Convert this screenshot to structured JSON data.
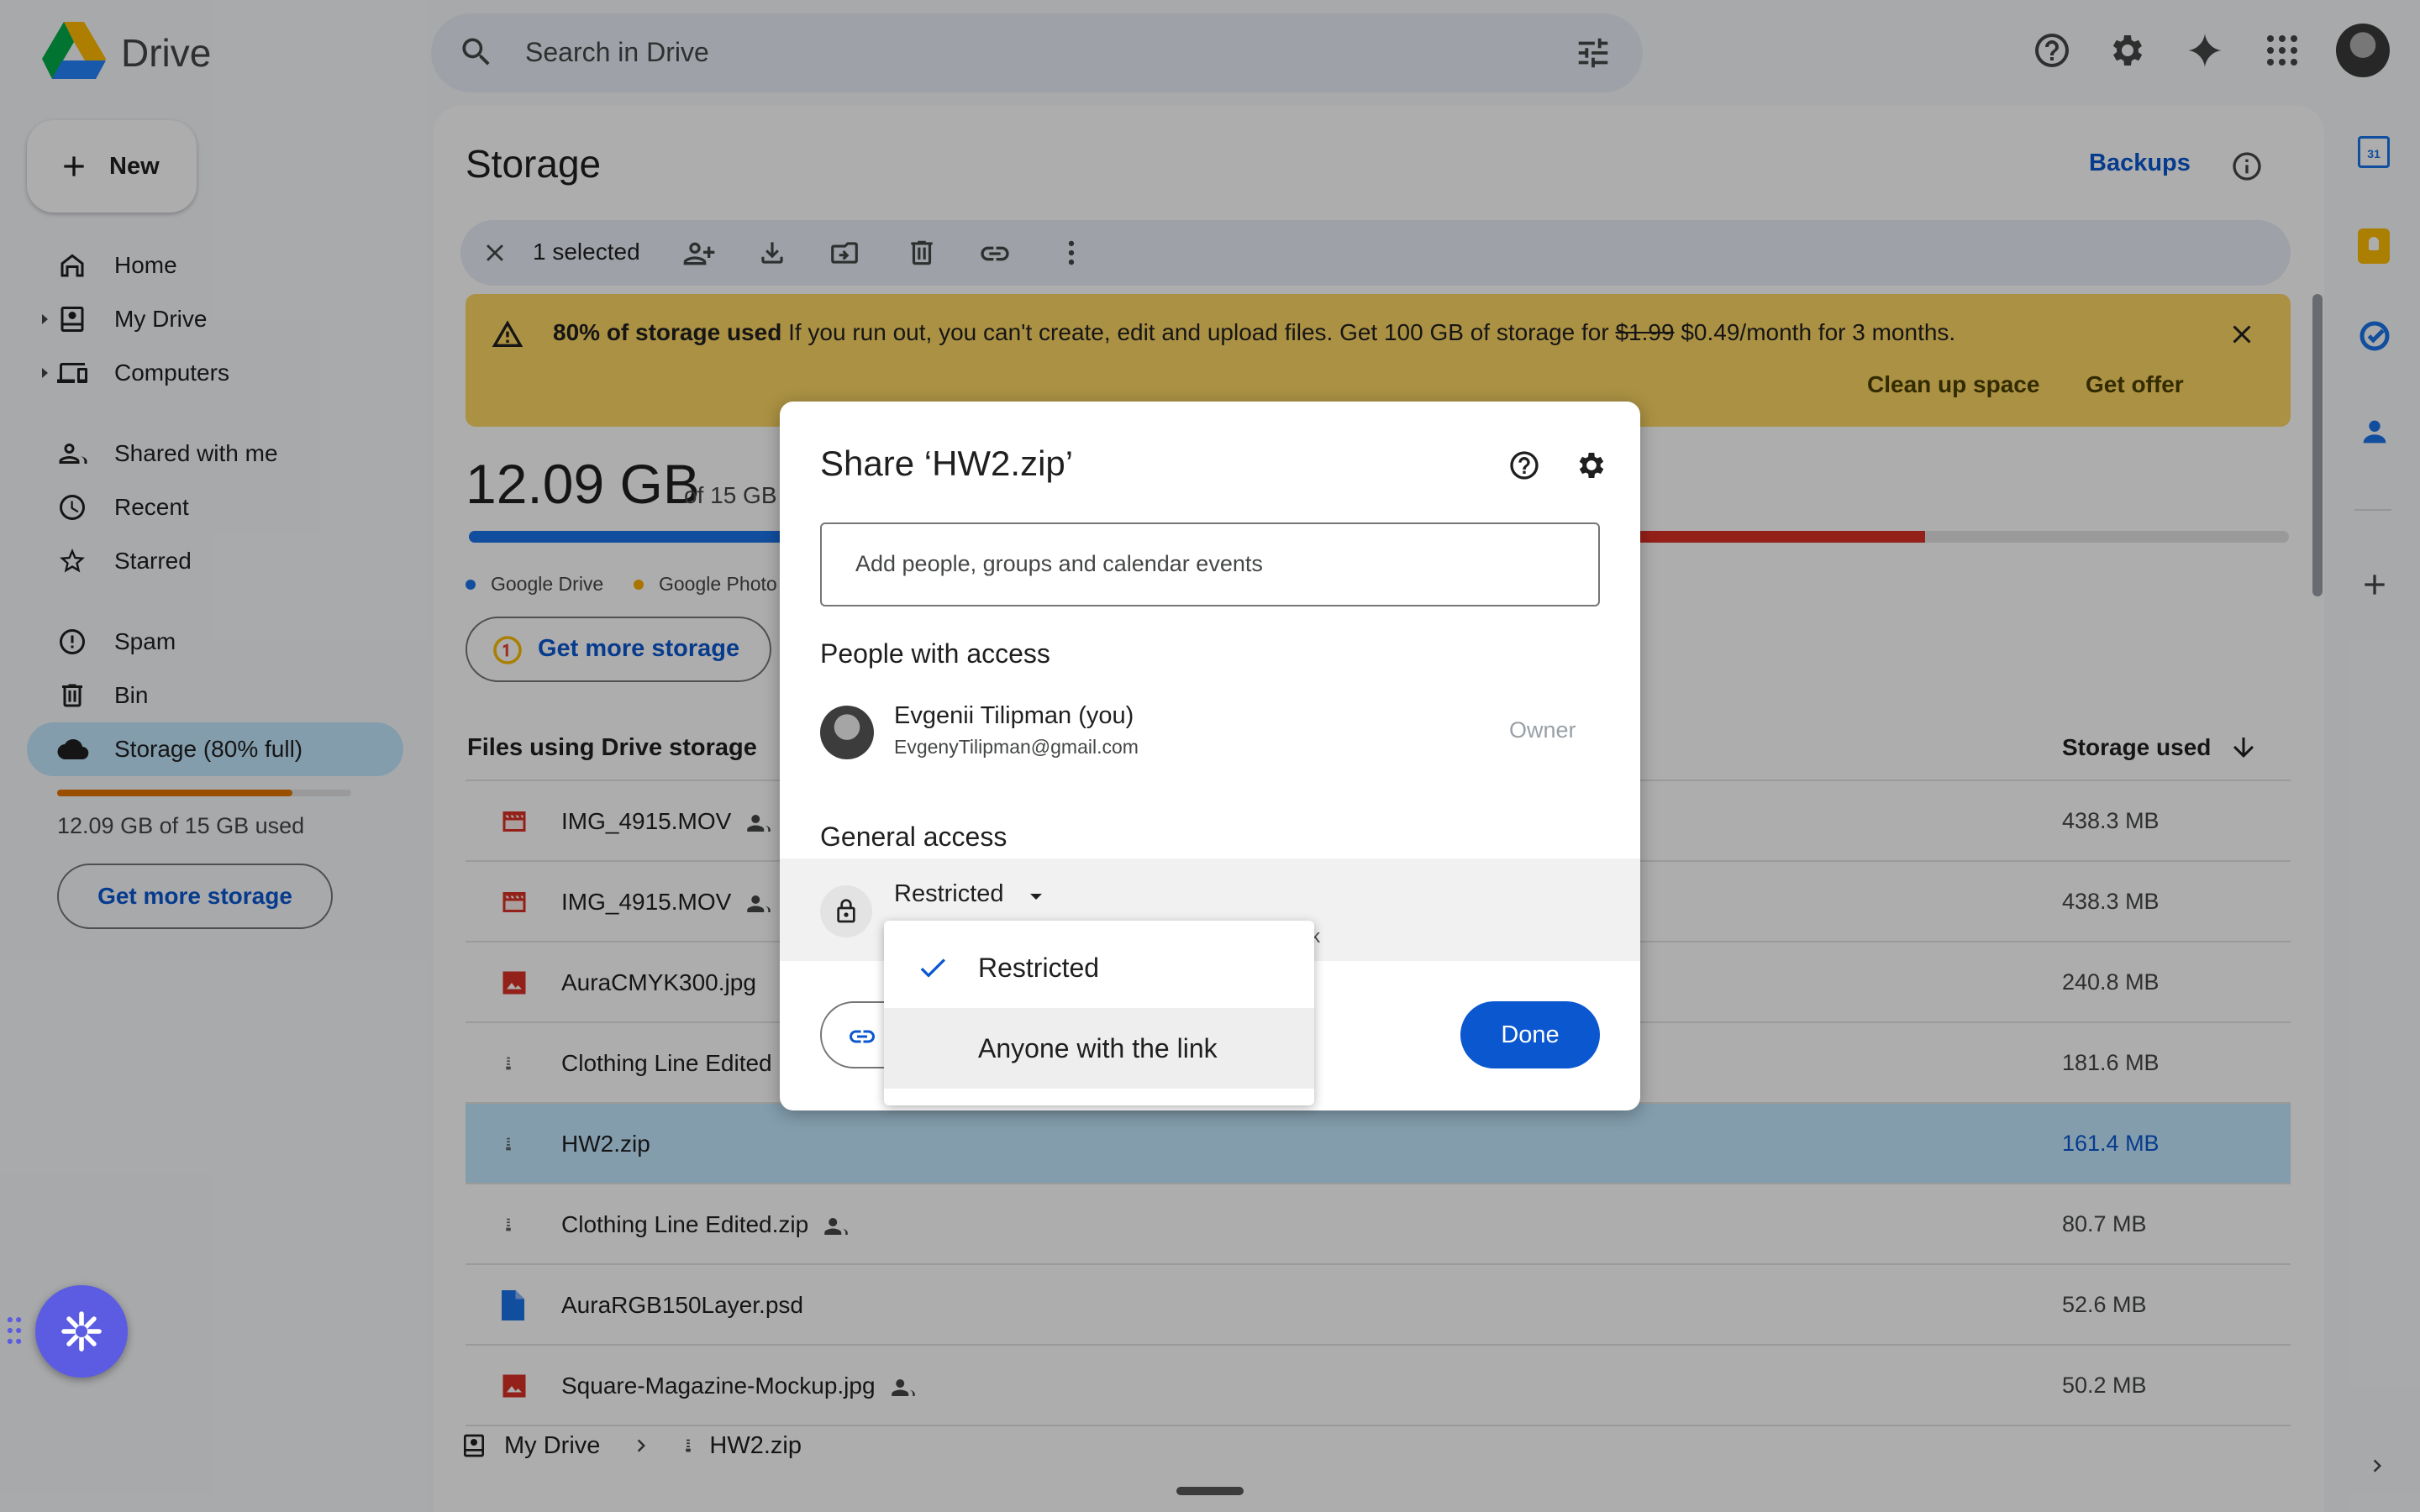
{
  "app": {
    "title": "Drive"
  },
  "search": {
    "placeholder": "Search in Drive"
  },
  "sidebar": {
    "new_label": "New",
    "items": [
      {
        "label": "Home"
      },
      {
        "label": "My Drive"
      },
      {
        "label": "Computers"
      },
      {
        "label": "Shared with me"
      },
      {
        "label": "Recent"
      },
      {
        "label": "Starred"
      },
      {
        "label": "Spam"
      },
      {
        "label": "Bin"
      },
      {
        "label": "Storage (80% full)"
      }
    ],
    "quota_text": "12.09 GB of 15 GB used",
    "quota_fraction": 0.8,
    "get_more": "Get more storage"
  },
  "page": {
    "title": "Storage",
    "backups": "Backups"
  },
  "selection": {
    "text": "1 selected"
  },
  "banner": {
    "bold": "80% of storage used",
    "text": "If you run out, you can't create, edit and upload files. Get 100 GB of storage for",
    "old_price": "$1.99",
    "new_price": "$0.49/month for 3 months.",
    "clean_up": "Clean up space",
    "get_offer": "Get offer"
  },
  "usage": {
    "used": "12.09 GB",
    "of_total": "of 15 GB",
    "legend_drive": "Google Drive",
    "legend_photos": "Google Photo",
    "get_more": "Get more storage"
  },
  "files": {
    "header_left": "Files using Drive storage",
    "header_right": "Storage used",
    "rows": [
      {
        "name": "IMG_4915.MOV",
        "size": "438.3 MB",
        "type": "video",
        "shared": true
      },
      {
        "name": "IMG_4915.MOV",
        "size": "438.3 MB",
        "type": "video",
        "shared": true
      },
      {
        "name": "AuraCMYK300.jpg",
        "size": "240.8 MB",
        "type": "image",
        "shared": false
      },
      {
        "name": "Clothing Line Edited",
        "size": "181.6 MB",
        "type": "zip",
        "shared": false
      },
      {
        "name": "HW2.zip",
        "size": "161.4 MB",
        "type": "zip",
        "shared": false
      },
      {
        "name": "Clothing Line Edited.zip",
        "size": "80.7 MB",
        "type": "zip",
        "shared": true
      },
      {
        "name": "AuraRGB150Layer.psd",
        "size": "52.6 MB",
        "type": "doc",
        "shared": false
      },
      {
        "name": "Square-Magazine-Mockup.jpg",
        "size": "50.2 MB",
        "type": "image",
        "shared": true
      }
    ]
  },
  "breadcrumb": {
    "root": "My Drive",
    "file": "HW2.zip"
  },
  "dialog": {
    "title": "Share ‘HW2.zip’",
    "input_placeholder": "Add people, groups and calendar events",
    "people_heading": "People with access",
    "person_name": "Evgenii Tilipman (you)",
    "person_email": "EvgenyTilipman@gmail.com",
    "person_role": "Owner",
    "general_heading": "General access",
    "access_value": "Restricted",
    "hint_fragment": "k",
    "done": "Done"
  },
  "menu": {
    "options": [
      {
        "label": "Restricted",
        "checked": true
      },
      {
        "label": "Anyone with the link",
        "checked": false
      }
    ]
  },
  "colors": {
    "accent": "#0b57d0",
    "banner": "#fdd663",
    "selected_row": "#c2e7ff",
    "usage_drive": "#1a73e8",
    "usage_photos": "#d93025"
  }
}
